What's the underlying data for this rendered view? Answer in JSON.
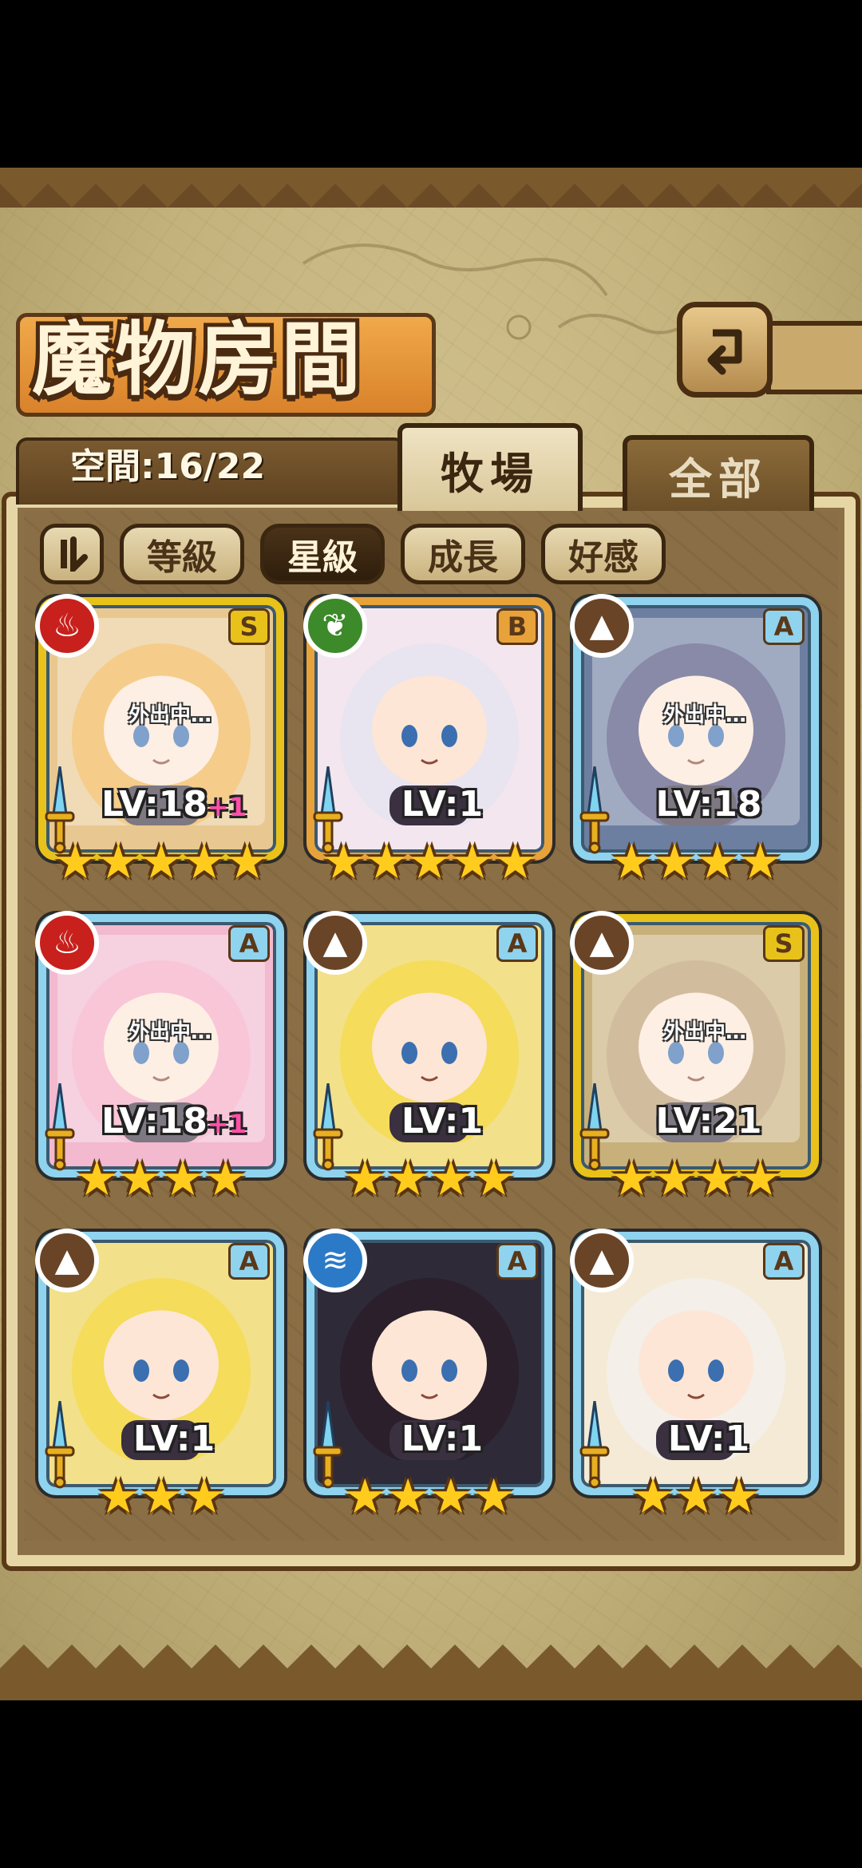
{
  "header": {
    "title": "魔物房間",
    "back_icon": "return-arrow-icon"
  },
  "tabs": {
    "space_text": "空間:16/22",
    "active": "牧場",
    "inactive": "全部"
  },
  "filters": {
    "toggle_icon": "sort-order-icon",
    "items": [
      "等級",
      "星級",
      "成長",
      "好感"
    ],
    "selected": "星級"
  },
  "cards": [
    {
      "rank": "S",
      "element": "fire",
      "lv": "LV:18",
      "plus": "+1",
      "stars": 5,
      "away": "外出中…",
      "frame": "gold"
    },
    {
      "rank": "B",
      "element": "leaf",
      "lv": "LV:1",
      "plus": "",
      "stars": 5,
      "away": "",
      "frame": "orange"
    },
    {
      "rank": "A",
      "element": "earth",
      "lv": "LV:18",
      "plus": "",
      "stars": 4,
      "away": "外出中…",
      "frame": "blue"
    },
    {
      "rank": "A",
      "element": "fire",
      "lv": "LV:18",
      "plus": "+1",
      "stars": 4,
      "away": "外出中…",
      "frame": "blue"
    },
    {
      "rank": "A",
      "element": "earth",
      "lv": "LV:1",
      "plus": "",
      "stars": 4,
      "away": "",
      "frame": "blue"
    },
    {
      "rank": "S",
      "element": "earth",
      "lv": "LV:21",
      "plus": "",
      "stars": 4,
      "away": "外出中…",
      "frame": "gold"
    },
    {
      "rank": "A",
      "element": "earth",
      "lv": "LV:1",
      "plus": "",
      "stars": 3,
      "away": "",
      "frame": "blue"
    },
    {
      "rank": "A",
      "element": "water",
      "lv": "LV:1",
      "plus": "",
      "stars": 4,
      "away": "",
      "frame": "blue"
    },
    {
      "rank": "A",
      "element": "earth",
      "lv": "LV:1",
      "plus": "",
      "stars": 3,
      "away": "",
      "frame": "blue"
    }
  ],
  "colors": {
    "gold_frame": "#e8c21a",
    "orange_frame": "#e8a23a",
    "blue_frame": "#8fd3ee",
    "fire": "#c8201c",
    "leaf": "#3c8a2a",
    "earth": "#6a4426",
    "water": "#2a7ac8"
  }
}
